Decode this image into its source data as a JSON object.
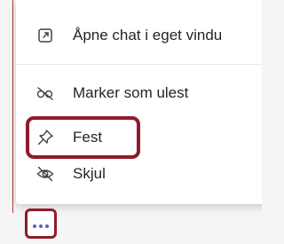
{
  "menu": {
    "items": [
      {
        "label": "Åpne chat i eget vindu",
        "icon": "popout-icon"
      },
      {
        "label": "Marker som ulest",
        "icon": "unread-eye-icon"
      },
      {
        "label": "Fest",
        "icon": "pin-icon"
      },
      {
        "label": "Skjul",
        "icon": "hide-eye-icon"
      }
    ]
  },
  "more_button": {
    "icon": "more-options-icon"
  },
  "colors": {
    "highlight": "#8e1c2a",
    "accent": "#5b5fc7",
    "text": "#242424",
    "icon": "#424242"
  }
}
